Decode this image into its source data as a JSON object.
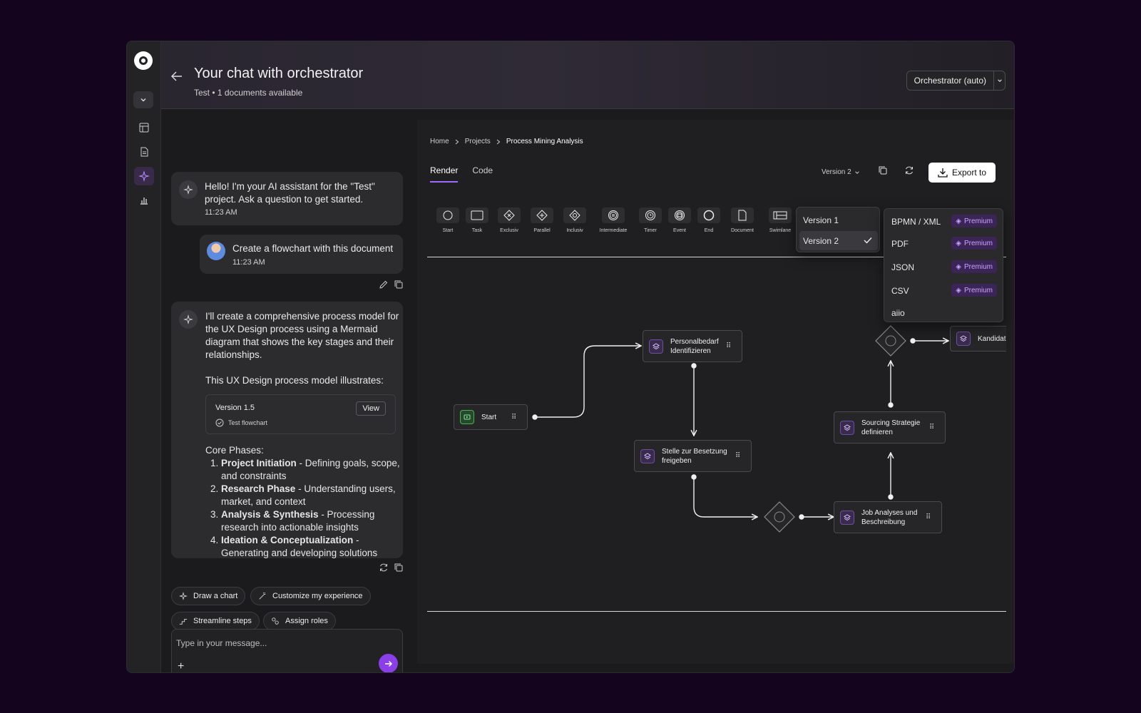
{
  "header": {
    "title": "Your chat with orchestrator",
    "subtitle": "Test • 1 documents available",
    "model_selector": "Orchestrator (auto)"
  },
  "chat": {
    "messages": [
      {
        "role": "assistant",
        "text": "Hello! I'm your AI assistant for the \"Test\" project. Ask a question to get started.",
        "time": "11:23 AM"
      },
      {
        "role": "user",
        "text": "Create a flowchart with this document",
        "time": "11:23 AM"
      },
      {
        "role": "assistant",
        "text": "I'll create a comprehensive process model for the UX Design process using a Mermaid diagram that shows the key stages and their relationships.",
        "text2": "This UX Design process model illustrates:"
      }
    ],
    "version_card": {
      "title": "Version 1.5",
      "status": "Test flowchart",
      "view_label": "View"
    },
    "phases_title": "Core Phases:",
    "phases": [
      {
        "name": "Project Initiation",
        "desc": " - Defining goals, scope, and constraints"
      },
      {
        "name": "Research Phase",
        "desc": " - Understanding users, market, and context"
      },
      {
        "name": "Analysis & Synthesis",
        "desc": " - Processing research into actionable insights"
      },
      {
        "name": "Ideation & Conceptualization",
        "desc": " - Generating and developing solutions"
      }
    ],
    "chips": [
      "Draw a chart",
      "Customize my experience",
      "Streamline steps",
      "Assign roles"
    ],
    "input_placeholder": "Type in your message..."
  },
  "panel": {
    "breadcrumb": [
      "Home",
      "Projects",
      "Process Mining Analysis"
    ],
    "tabs": [
      "Render",
      "Code"
    ],
    "version_selector": "Version 2",
    "export_label": "Export to",
    "tools": [
      "Start",
      "Task",
      "Exclusiv",
      "Parallel",
      "Inclusiv",
      "Intermediate",
      "Timer",
      "Event",
      "End",
      "Document",
      "Swimlane"
    ],
    "version_menu": [
      "Version 1",
      "Version 2"
    ],
    "export_menu": [
      {
        "label": "BPMN / XML",
        "badge": "Premium"
      },
      {
        "label": "PDF",
        "badge": "Premium"
      },
      {
        "label": "JSON",
        "badge": "Premium"
      },
      {
        "label": "CSV",
        "badge": "Premium"
      },
      {
        "label": "aiio",
        "badge": ""
      }
    ],
    "nodes": {
      "start": "Start",
      "personalbedarf": "Personalbedarf Identifizieren",
      "stelle": "Stelle zur Besetzung freigeben",
      "job": "Job Analyses und Beschreibung",
      "sourcing": "Sourcing Strategie definieren",
      "kandidat": "Kandidat"
    }
  },
  "colors": {
    "accent": "#8b3fe8",
    "background": "#14041d",
    "premium": "#c9a3ff"
  }
}
